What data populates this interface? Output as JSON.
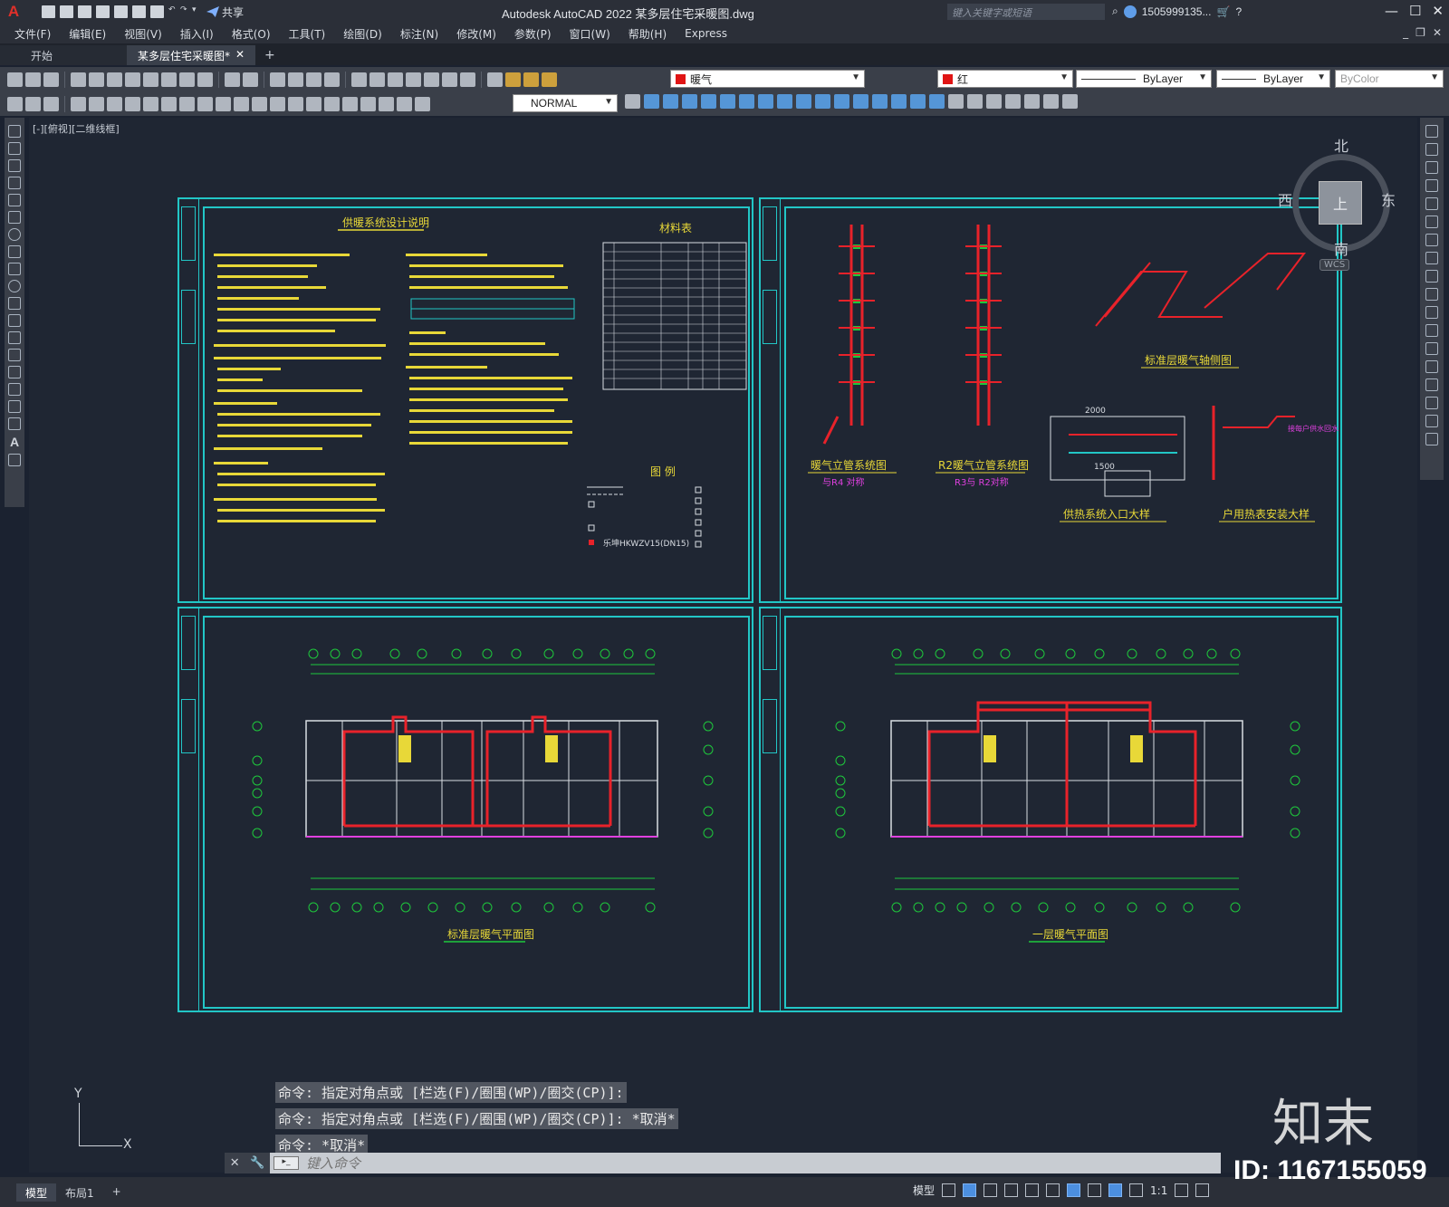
{
  "app": {
    "title": "Autodesk AutoCAD 2022    某多层住宅采暖图.dwg",
    "logo": "A",
    "share_label": "共享",
    "search_placeholder": "键入关键字或短语",
    "user": "1505999135...",
    "window_controls": [
      "—",
      "☐",
      "✕"
    ]
  },
  "menu": [
    "文件(F)",
    "编辑(E)",
    "视图(V)",
    "插入(I)",
    "格式(O)",
    "工具(T)",
    "绘图(D)",
    "标注(N)",
    "修改(M)",
    "参数(P)",
    "窗口(W)",
    "帮助(H)",
    "Express"
  ],
  "tabs": {
    "home": "开始",
    "active": "某多层住宅采暖图*",
    "close": "✕",
    "add": "+"
  },
  "toolbar": {
    "layer": "暖气",
    "color": "红",
    "linetype": "ByLayer",
    "lineweight": "ByLayer",
    "plotstyle": "ByColor",
    "text_style": "NORMAL",
    "colors": {
      "layer_swatch": "#e01515",
      "accent": "#22c6c6",
      "pipe_red": "#e8222a",
      "pipe_green": "#1ec83c",
      "text_yellow": "#e8d838",
      "magenta": "#e040e0"
    }
  },
  "view": {
    "label": "[-][俯视][二维线框]"
  },
  "viewcube": {
    "north": "北",
    "south": "南",
    "west": "西",
    "east": "东",
    "face": "上",
    "wcs": "WCS"
  },
  "drawing": {
    "sheet1_title": "供暖系统设计说明",
    "materials_title": "材料表",
    "legend_title": "图 例",
    "legend_item": "乐坤HKWZV15(DN15)",
    "riser1_title": "暖气立管系统图",
    "riser1_sub": "与R4 对称",
    "riser2_title": "R2暖气立管系统图",
    "riser2_sub": "R3与 R2对称",
    "axon_title": "标准层暖气轴侧图",
    "entrance_title": "供热系统入口大样",
    "meter_title": "户用热表安装大样",
    "meter_note": "接每户供水回水",
    "dim1": "2000",
    "dim2": "1500",
    "plan1_title": "标准层暖气平面图",
    "plan2_title": "一层暖气平面图"
  },
  "ucs": {
    "x": "X",
    "y": "Y"
  },
  "command": {
    "history": [
      "命令: 指定对角点或 [栏选(F)/圈围(WP)/圈交(CP)]:",
      "命令: 指定对角点或 [栏选(F)/圈围(WP)/圈交(CP)]: *取消*",
      "命令: *取消*"
    ],
    "placeholder": "键入命令"
  },
  "status": {
    "layout_tabs": [
      "模型",
      "布局1"
    ],
    "add": "+",
    "model_label": "模型",
    "scale": "1:1"
  },
  "watermark": {
    "logo": "知末",
    "id": "ID: 1167155059"
  }
}
